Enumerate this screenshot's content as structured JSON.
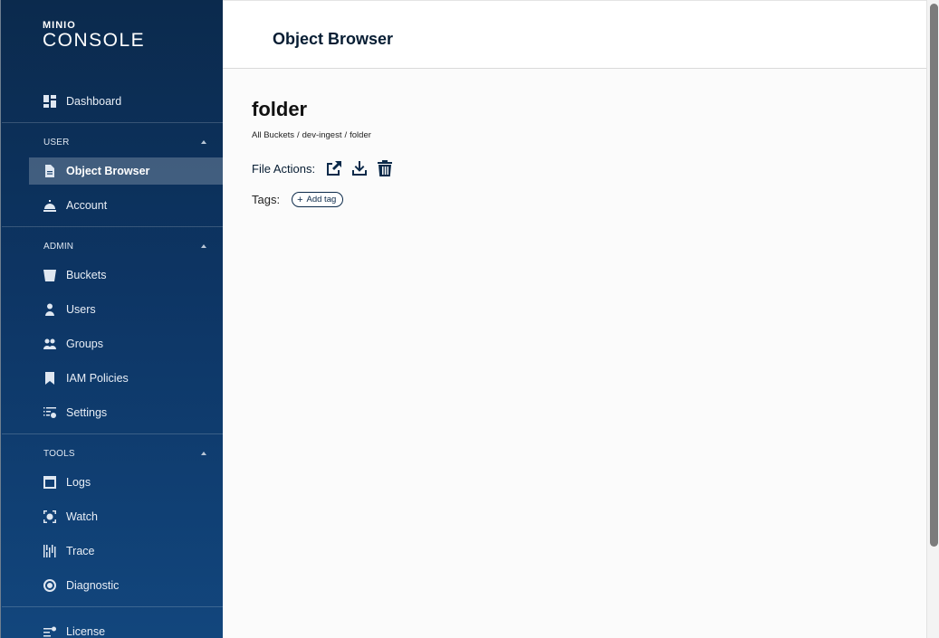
{
  "brand": {
    "small": "MINIO",
    "big": "CONSOLE"
  },
  "nav": {
    "dashboard": "Dashboard",
    "user_section": "USER",
    "object_browser": "Object Browser",
    "account": "Account",
    "admin_section": "ADMIN",
    "buckets": "Buckets",
    "users": "Users",
    "groups": "Groups",
    "iam_policies": "IAM Policies",
    "settings": "Settings",
    "tools_section": "TOOLS",
    "logs": "Logs",
    "watch": "Watch",
    "trace": "Trace",
    "diagnostic": "Diagnostic",
    "license": "License"
  },
  "header": {
    "title": "Object Browser"
  },
  "main": {
    "folder_name": "folder",
    "breadcrumb": {
      "all": "All Buckets",
      "sep": "/",
      "bucket": "dev-ingest",
      "folder": "folder"
    },
    "file_actions_label": "File Actions:",
    "tags_label": "Tags:",
    "add_tag_label": "Add tag",
    "add_tag_plus": "+"
  }
}
